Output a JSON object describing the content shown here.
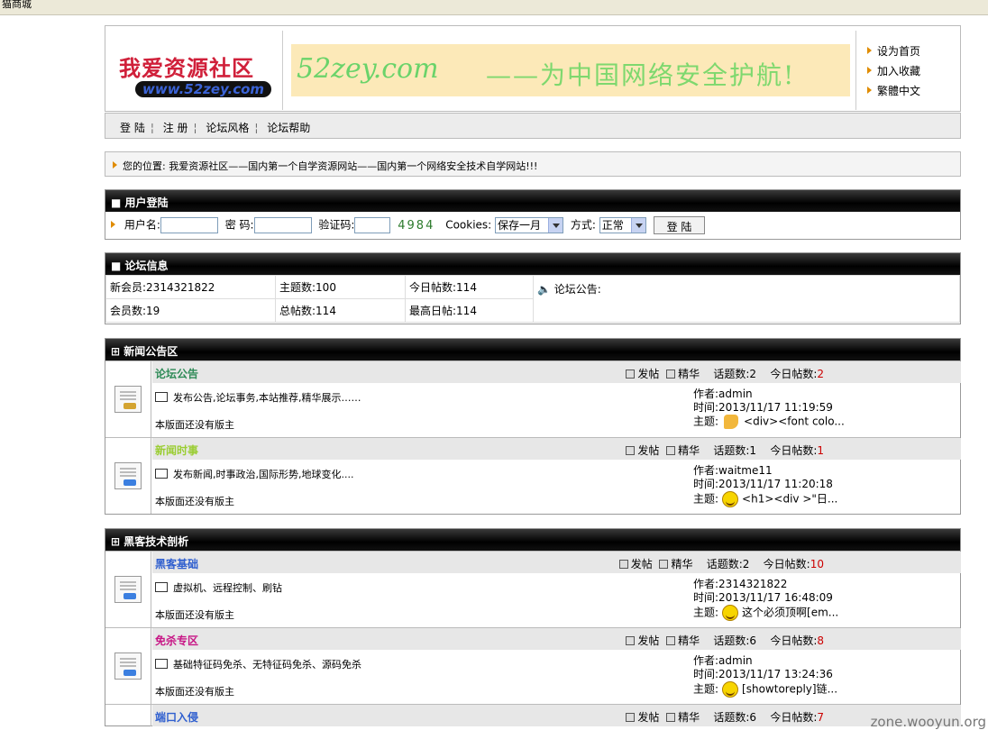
{
  "top_strip": "猫商城",
  "header": {
    "logo_text": "我爱资源社区",
    "logo_url": "www.52zey.com",
    "banner_site": "52zey.com",
    "banner_slogan": "——为中国网络安全护航!",
    "side_links": [
      "设为首页",
      "加入收藏",
      "繁體中文"
    ]
  },
  "nav": [
    "登 陆",
    "注 册",
    "论坛风格",
    "论坛帮助"
  ],
  "location": {
    "label": "您的位置:",
    "path": "我爱资源社区——国内第一个自学资源网站——国内第一个网络安全技术自学网站!!!"
  },
  "login": {
    "title": "用户登陆",
    "username_label": "用户名:",
    "password_label": "密 码:",
    "captcha_label": "验证码:",
    "captcha_code": "4984",
    "cookies_label": "Cookies:",
    "cookies_value": "保存一月",
    "mode_label": "方式:",
    "mode_value": "正常",
    "submit": "登 陆"
  },
  "forum_info": {
    "title": "论坛信息",
    "new_member": "新会员:2314321822",
    "topics": "主题数:100",
    "today_posts": "今日帖数:114",
    "announcement": "论坛公告:",
    "members": "会员数:19",
    "total_posts": "总帖数:114",
    "max_posts": "最高日帖:114"
  },
  "sections": [
    {
      "title": "新闻公告区",
      "boards": [
        {
          "name": "论坛公告",
          "name_color": "#2e8b57",
          "icon": "gold",
          "post": "发帖",
          "elite": "精华",
          "topics": "话题数:2",
          "today_label": "今日帖数:",
          "today": "2",
          "desc": "发布公告,论坛事务,本站推荐,精华展示……",
          "moderator": "本版面还没有版主",
          "author": "作者:admin",
          "time": "时间:2013/11/17 11:19:59",
          "subject_label": "主题:",
          "subject": "<div><font colo...",
          "emote": "thumb"
        },
        {
          "name": "新闻时事",
          "name_color": "#9acd32",
          "icon": "blue",
          "post": "发帖",
          "elite": "精华",
          "topics": "话题数:1",
          "today_label": "今日帖数:",
          "today": "1",
          "desc": "发布新闻,时事政治,国际形势,地球变化....",
          "moderator": "本版面还没有版主",
          "author": "作者:waitme11",
          "time": "时间:2013/11/17 11:20:18",
          "subject_label": "主题:",
          "subject": "<h1><div >\"日...",
          "emote": "smile"
        }
      ]
    },
    {
      "title": "黑客技术剖析",
      "boards": [
        {
          "name": "黑客基础",
          "name_color": "#2f5fcf",
          "icon": "blue",
          "post": "发帖",
          "elite": "精华",
          "topics": "话题数:2",
          "today_label": "今日帖数:",
          "today": "10",
          "desc": "虚拟机、远程控制、刷钻",
          "moderator": "本版面还没有版主",
          "author": "作者:2314321822",
          "time": "时间:2013/11/17 16:48:09",
          "subject_label": "主题:",
          "subject": "这个必须顶啊[em...",
          "emote": "smile"
        },
        {
          "name": "免杀专区",
          "name_color": "#c71585",
          "icon": "blue",
          "post": "发帖",
          "elite": "精华",
          "topics": "话题数:6",
          "today_label": "今日帖数:",
          "today": "8",
          "desc": "基础特征码免杀、无特征码免杀、源码免杀",
          "moderator": "本版面还没有版主",
          "author": "作者:admin",
          "time": "时间:2013/11/17 13:24:36",
          "subject_label": "主题:",
          "subject": "[showtoreply]链...",
          "emote": "smile"
        },
        {
          "name": "端口入侵",
          "name_color": "#2f5fcf",
          "icon": "blue",
          "post": "发帖",
          "elite": "精华",
          "topics": "话题数:6",
          "today_label": "今日帖数:",
          "today": "7",
          "desc": "",
          "moderator": "",
          "author": "",
          "time": "",
          "subject_label": "",
          "subject": "",
          "emote": ""
        }
      ]
    }
  ],
  "watermark": "zone.wooyun.org",
  "colors": {
    "today_count": "#cc0000",
    "section_header": "#000000"
  }
}
